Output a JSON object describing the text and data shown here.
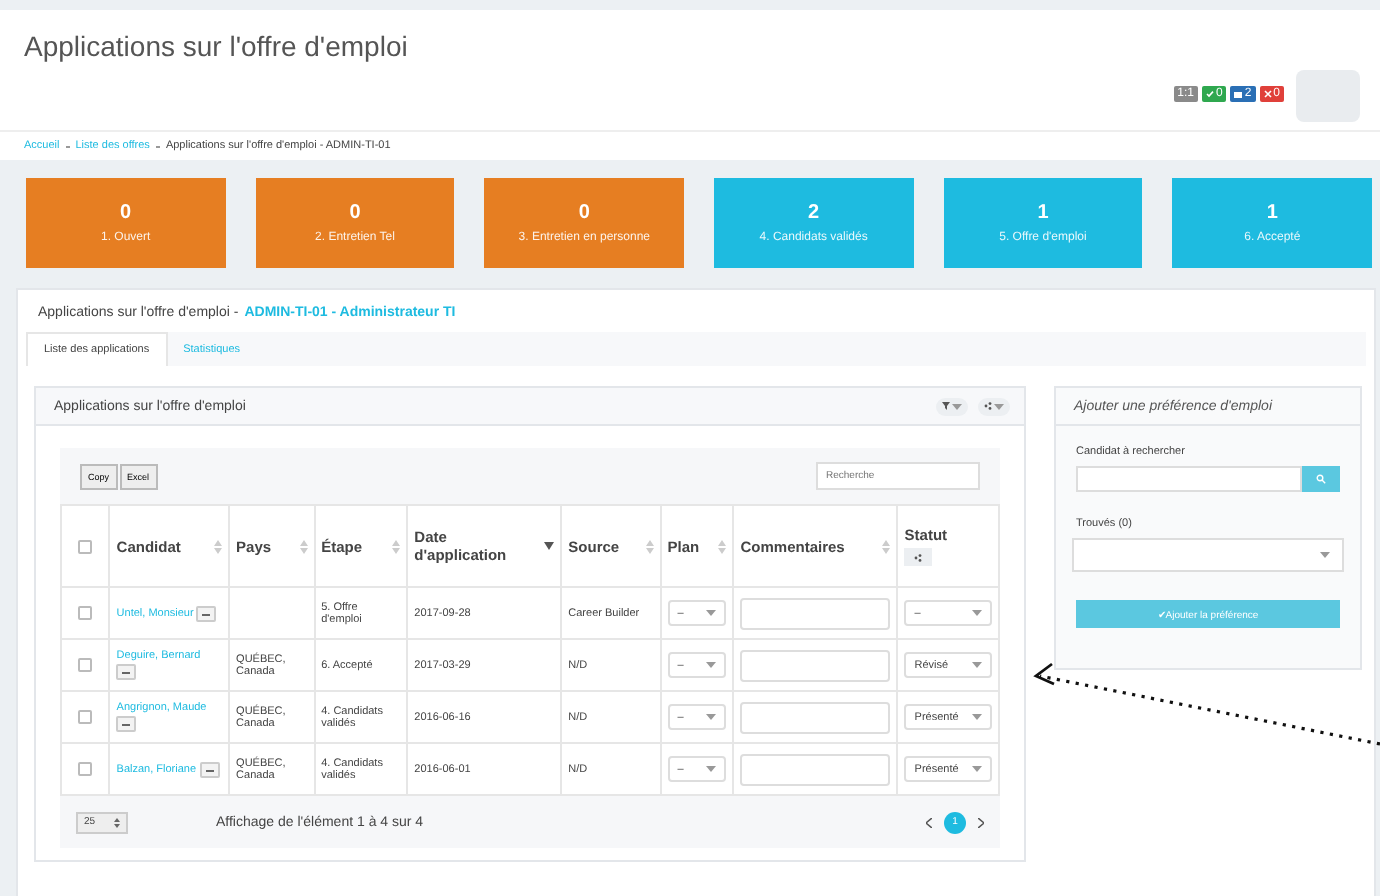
{
  "header": {
    "title": "Applications sur l'offre d'emploi",
    "badges": [
      {
        "kind": "neutral",
        "text": "1:1",
        "color": "#8a8a8a"
      },
      {
        "kind": "check",
        "text": "0",
        "color": "#2fa84f"
      },
      {
        "kind": "mail",
        "text": "2",
        "color": "#2a6fb5"
      },
      {
        "kind": "cross",
        "text": "0",
        "color": "#e0403a"
      }
    ]
  },
  "breadcrumb": [
    {
      "label": "Accueil",
      "link": true
    },
    {
      "label": "Liste des offres",
      "link": true
    },
    {
      "label": "Applications sur l'offre d'emploi - ADMIN-TI-01",
      "link": false
    }
  ],
  "stages": [
    {
      "count": "0",
      "label": "1. Ouvert",
      "color": "#e67e22"
    },
    {
      "count": "0",
      "label": "2. Entretien Tel",
      "color": "#e67e22"
    },
    {
      "count": "0",
      "label": "3. Entretien en personne",
      "color": "#e67e22"
    },
    {
      "count": "2",
      "label": "4. Candidats validés",
      "color": "#1ebbe0"
    },
    {
      "count": "1",
      "label": "5. Offre d'emploi",
      "color": "#1ebbe0"
    },
    {
      "count": "1",
      "label": "6. Accepté",
      "color": "#1ebbe0"
    }
  ],
  "panel": {
    "title": "Applications sur l'offre d'emploi - ",
    "title_link": "ADMIN-TI-01 - Administrateur TI",
    "tabs": [
      {
        "label": "Liste des applications",
        "selected": true
      },
      {
        "label": "Statistiques",
        "selected": false
      }
    ]
  },
  "list_box": {
    "title": "Applications sur l'offre d'emploi",
    "export_buttons": [
      "Copy",
      "Excel"
    ],
    "search_placeholder": "Recherche",
    "select_all_checked": false,
    "columns": [
      "Candidat",
      "Pays",
      "Étape",
      "Date d'application",
      "Source",
      "Plan",
      "Commentaires",
      "Statut"
    ],
    "rows": [
      {
        "checked": false,
        "candidate": "Untel, Monsieur",
        "country": "",
        "stage": "5. Offre d'emploi",
        "date": "2017-09-28",
        "source": "Career Builder",
        "plan": "–",
        "status": "–"
      },
      {
        "checked": false,
        "candidate": "Deguire, Bernard",
        "country": "QUÉBEC, Canada",
        "stage": "6. Accepté",
        "date": "2017-03-29",
        "source": "N/D",
        "plan": "–",
        "status": "Révisé"
      },
      {
        "checked": false,
        "candidate": "Angrignon, Maude",
        "country": "QUÉBEC, Canada",
        "stage": "4. Candidats validés",
        "date": "2016-06-16",
        "source": "N/D",
        "plan": "–",
        "status": "Présenté"
      },
      {
        "checked": false,
        "candidate": "Balzan, Floriane",
        "country": "QUÉBEC, Canada",
        "stage": "4. Candidats validés",
        "date": "2016-06-01",
        "source": "N/D",
        "plan": "–",
        "status": "Présenté"
      }
    ],
    "page_size": "25",
    "info": "Affichage de l'élément 1 à 4 sur 4",
    "pages": [
      {
        "label": "1",
        "selected": true
      }
    ]
  },
  "preference": {
    "title": "Ajouter une préférence d'emploi",
    "search_label": "Candidat à rechercher",
    "found_label": "Trouvés (0)",
    "submit": "✔Ajouter la préférence"
  }
}
